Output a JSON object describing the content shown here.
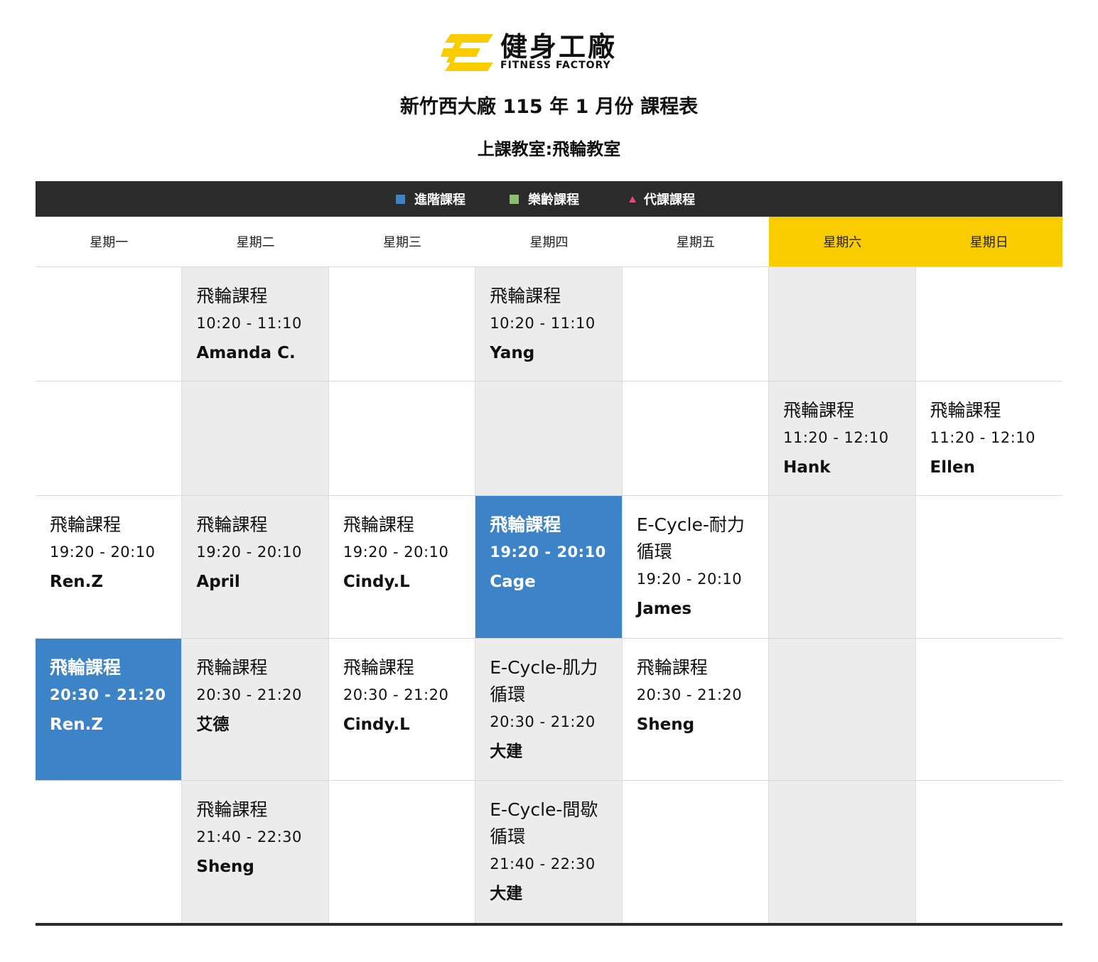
{
  "brand": {
    "name_cn": "健身工廠",
    "name_en": "FITNESS FACTORY",
    "accent_color": "#f9cc00"
  },
  "title": "新竹西大廠 115 年 1 月份 課程表",
  "subtitle": "上課教室:飛輪教室",
  "legend": [
    {
      "label": "進階課程",
      "color": "#3d83c7",
      "shape": "square"
    },
    {
      "label": "樂齡課程",
      "color": "#8cc06c",
      "shape": "square"
    },
    {
      "label": "代課課程",
      "color": "#e24a7b",
      "shape": "triangle"
    }
  ],
  "days": [
    "星期一",
    "星期二",
    "星期三",
    "星期四",
    "星期五",
    "星期六",
    "星期日"
  ],
  "rows": [
    {
      "cells": [
        {
          "bg": "white"
        },
        {
          "bg": "grey",
          "name": "飛輪課程",
          "time": "10:20 - 11:10",
          "coach": "Amanda C."
        },
        {
          "bg": "white"
        },
        {
          "bg": "grey",
          "name": "飛輪課程",
          "time": "10:20 - 11:10",
          "coach": "Yang"
        },
        {
          "bg": "white"
        },
        {
          "bg": "grey"
        },
        {
          "bg": "white"
        }
      ]
    },
    {
      "cells": [
        {
          "bg": "white"
        },
        {
          "bg": "grey"
        },
        {
          "bg": "white"
        },
        {
          "bg": "grey"
        },
        {
          "bg": "white"
        },
        {
          "bg": "grey",
          "name": "飛輪課程",
          "time": "11:20 - 12:10",
          "coach": "Hank"
        },
        {
          "bg": "white",
          "name": "飛輪課程",
          "time": "11:20 - 12:10",
          "coach": "Ellen"
        }
      ]
    },
    {
      "cells": [
        {
          "bg": "white",
          "name": "飛輪課程",
          "time": "19:20 - 20:10",
          "coach": "Ren.Z"
        },
        {
          "bg": "grey",
          "name": "飛輪課程",
          "time": "19:20 - 20:10",
          "coach": "April"
        },
        {
          "bg": "white",
          "name": "飛輪課程",
          "time": "19:20 - 20:10",
          "coach": "Cindy.L"
        },
        {
          "bg": "blue",
          "name": "飛輪課程",
          "time": "19:20 - 20:10",
          "coach": "Cage"
        },
        {
          "bg": "white",
          "name": "E-Cycle-耐力循環",
          "time": "19:20 - 20:10",
          "coach": "James"
        },
        {
          "bg": "grey"
        },
        {
          "bg": "white"
        }
      ]
    },
    {
      "cells": [
        {
          "bg": "blue",
          "name": "飛輪課程",
          "time": "20:30 - 21:20",
          "coach": "Ren.Z"
        },
        {
          "bg": "grey",
          "name": "飛輪課程",
          "time": "20:30 - 21:20",
          "coach": "艾德"
        },
        {
          "bg": "white",
          "name": "飛輪課程",
          "time": "20:30 - 21:20",
          "coach": "Cindy.L"
        },
        {
          "bg": "grey",
          "name": "E-Cycle-肌力循環",
          "time": "20:30 - 21:20",
          "coach": "大建"
        },
        {
          "bg": "white",
          "name": "飛輪課程",
          "time": "20:30 - 21:20",
          "coach": "Sheng"
        },
        {
          "bg": "grey"
        },
        {
          "bg": "white"
        }
      ]
    },
    {
      "cells": [
        {
          "bg": "white"
        },
        {
          "bg": "grey",
          "name": "飛輪課程",
          "time": "21:40 - 22:30",
          "coach": "Sheng"
        },
        {
          "bg": "white"
        },
        {
          "bg": "grey",
          "name": "E-Cycle-間歇循環",
          "time": "21:40 - 22:30",
          "coach": "大建"
        },
        {
          "bg": "white"
        },
        {
          "bg": "grey"
        },
        {
          "bg": "white"
        }
      ]
    }
  ]
}
